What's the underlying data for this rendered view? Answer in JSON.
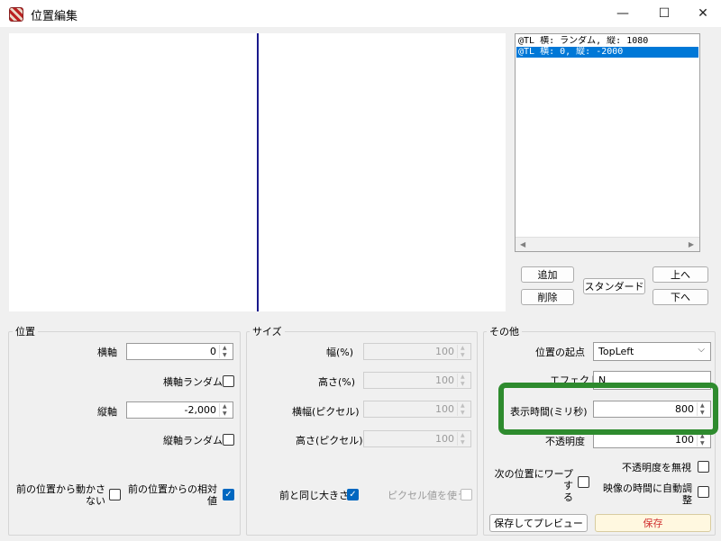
{
  "window": {
    "title": "位置編集",
    "controls": {
      "minimize": "—",
      "maximize": "☐",
      "close": "✕"
    }
  },
  "list": {
    "items": [
      {
        "text": "@TL 横: ランダム, 縦: 1080",
        "selected": false
      },
      {
        "text": "@TL 横: 0, 縦: -2000",
        "selected": true
      }
    ]
  },
  "list_buttons": {
    "add": "追加",
    "delete": "削除",
    "standard": "スタンダード",
    "up": "上へ",
    "down": "下へ"
  },
  "position_group": {
    "title": "位置",
    "h_axis_label": "横軸",
    "h_axis_value": "0",
    "h_random_label": "横軸ランダム",
    "v_axis_label": "縦軸",
    "v_axis_value": "-2,000",
    "v_random_label": "縦軸ランダム",
    "no_move_label": "前の位置から動かさ\nない",
    "relative_label": "前の位置からの相対\n値"
  },
  "size_group": {
    "title": "サイズ",
    "width_pct_label": "幅(%)",
    "width_pct_value": "100",
    "height_pct_label": "高さ(%)",
    "height_pct_value": "100",
    "width_px_label": "横幅(ピクセル)",
    "width_px_value": "100",
    "height_px_label": "高さ(ピクセル)",
    "height_px_value": "100",
    "same_size_label": "前と同じ大きさ",
    "use_px_label": "ピクセル値を使う"
  },
  "other_group": {
    "title": "その他",
    "origin_label": "位置の起点",
    "origin_value": "TopLeft",
    "effect_label": "エフェクト",
    "effect_value": "N",
    "display_time_label": "表示時間(ミリ秒)",
    "display_time_value": "800",
    "opacity_label": "不透明度",
    "opacity_value": "100",
    "ignore_opacity_label": "不透明度を無視",
    "warp_label": "次の位置にワープす\nる",
    "auto_adjust_label": "映像の時間に自動調\n整"
  },
  "footer": {
    "save_preview": "保存してプレビュー",
    "save": "保存"
  },
  "colors": {
    "accent": "#0078d7",
    "annotation": "#2e8b2e",
    "save_bg": "#fff8e0",
    "save_text": "#d03030"
  },
  "checkbox_states": {
    "h_random": false,
    "v_random": false,
    "no_move": false,
    "relative": true,
    "same_size": true,
    "use_px": false,
    "ignore_opacity": false,
    "warp": false,
    "auto_adjust": false
  }
}
